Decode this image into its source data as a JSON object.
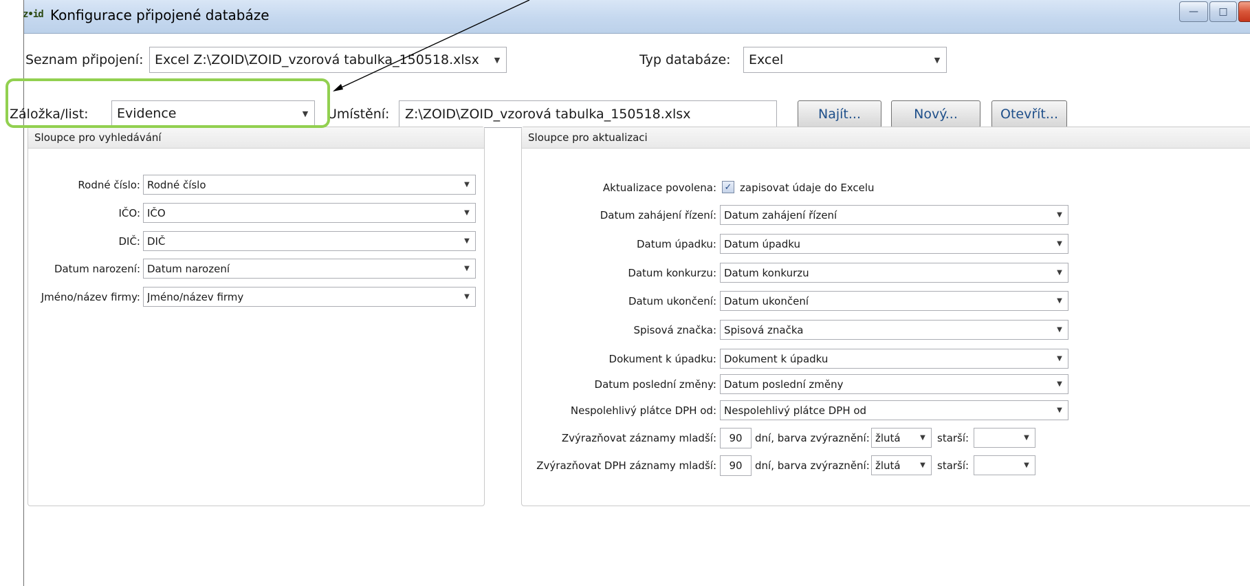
{
  "window": {
    "logo_text": "z•id",
    "title": "Konfigurace připojené databáze",
    "controls": {
      "minimize": "—",
      "maximize": "□",
      "close": "✕"
    }
  },
  "top": {
    "connection_label": "Seznam připojení:",
    "connection_value": "Excel Z:\\ZOID\\ZOID_vzorová tabulka_150518.xlsx",
    "db_type_label": "Typ databáze:",
    "db_type_value": "Excel",
    "sheet_label": "Záložka/list:",
    "sheet_value": "Evidence",
    "location_label": "Umístění:",
    "location_value": "Z:\\ZOID\\ZOID_vzorová tabulka_150518.xlsx",
    "find_button": "Najít...",
    "new_button": "Nový...",
    "open_button": "Otevřít..."
  },
  "search_columns": {
    "header": "Sloupce pro vyhledávání",
    "rows": [
      {
        "label": "Rodné číslo:",
        "value": "Rodné číslo"
      },
      {
        "label": "IČO:",
        "value": "IČO"
      },
      {
        "label": "DIČ:",
        "value": "DIČ"
      },
      {
        "label": "Datum narození:",
        "value": "Datum narození"
      },
      {
        "label": "Jméno/název firmy:",
        "value": "Jméno/název firmy"
      }
    ]
  },
  "update_columns": {
    "header": "Sloupce pro aktualizaci",
    "enabled_label": "Aktualizace povolena:",
    "enabled_checked": true,
    "enabled_text": "zapisovat údaje do Excelu",
    "rows": [
      {
        "label": "Datum zahájení řízení:",
        "value": "Datum zahájení řízení"
      },
      {
        "label": "Datum úpadku:",
        "value": "Datum úpadku"
      },
      {
        "label": "Datum konkurzu:",
        "value": "Datum konkurzu"
      },
      {
        "label": "Datum ukončení:",
        "value": "Datum ukončení"
      },
      {
        "label": "Spisová značka:",
        "value": "Spisová značka"
      },
      {
        "label": "Dokument k úpadku:",
        "value": "Dokument k úpadku"
      },
      {
        "label": "Datum poslední změny:",
        "value": "Datum poslední změny"
      },
      {
        "label": "Nespolehlivý plátce DPH od:",
        "value": "Nespolehlivý plátce DPH od"
      }
    ],
    "highlight_rows": [
      {
        "label": "Zvýrazňovat záznamy mladší:",
        "days": "90",
        "color_label": "dní, barva zvýraznění:",
        "color_value": "žlutá",
        "older_label": "starší:",
        "older_value": ""
      },
      {
        "label": "Zvýrazňovat DPH záznamy mladší:",
        "days": "90",
        "color_label": "dní, barva zvýraznění:",
        "color_value": "žlutá",
        "older_label": "starší:",
        "older_value": ""
      }
    ]
  },
  "annotation": {
    "highlight_color": "#92d050",
    "arrow_color": "#000000"
  }
}
